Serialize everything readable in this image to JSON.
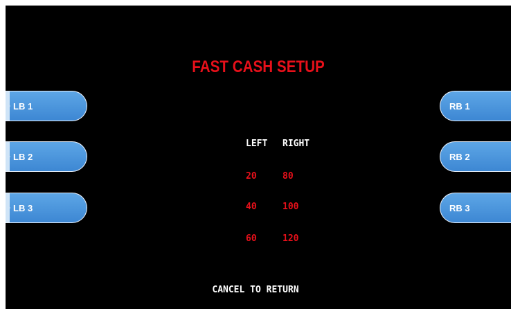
{
  "screen": {
    "title": "FAST CASH SETUP",
    "footer": "CANCEL TO RETURN",
    "accent_color": "#e8101a",
    "button_color": "#4a95dc"
  },
  "left_buttons": [
    {
      "label": "LB 1"
    },
    {
      "label": "LB 2"
    },
    {
      "label": "LB 3"
    }
  ],
  "right_buttons": [
    {
      "label": "RB 1"
    },
    {
      "label": "RB 2"
    },
    {
      "label": "RB 3"
    }
  ],
  "table": {
    "headers": [
      "LEFT",
      "RIGHT"
    ],
    "rows": [
      {
        "left": "20",
        "right": "80"
      },
      {
        "left": "40",
        "right": "100"
      },
      {
        "left": "60",
        "right": "120"
      }
    ]
  }
}
